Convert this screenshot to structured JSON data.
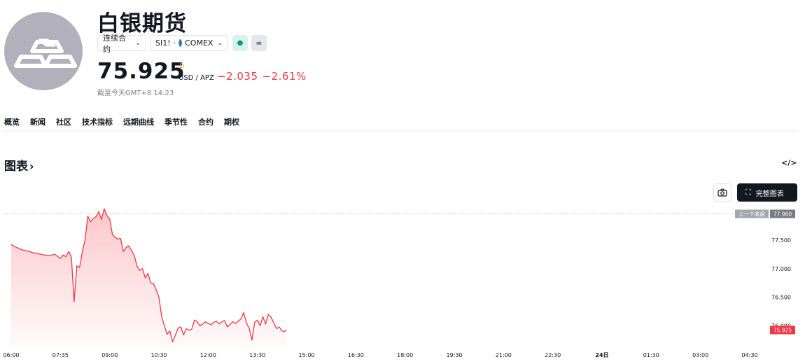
{
  "header": {
    "title": "白银期货",
    "contract_selector": "连续合约",
    "symbol": "SI1!",
    "exchange": "COMEX",
    "price": "75.925",
    "price_flag": "D",
    "currency": "USD / APZ",
    "change": "−2.035",
    "change_pct": "−2.61%",
    "asof": "截至今天GMT+8 14:23"
  },
  "tabs": [
    {
      "label": "概览"
    },
    {
      "label": "新闻"
    },
    {
      "label": "社区"
    },
    {
      "label": "技术指标"
    },
    {
      "label": "远期曲线"
    },
    {
      "label": "季节性"
    },
    {
      "label": "合约"
    },
    {
      "label": "期权"
    }
  ],
  "section": {
    "title": "图表",
    "embed": "</>",
    "fullchart": "完整图表"
  },
  "chart_data": {
    "type": "area",
    "x_ticks": [
      "06:00",
      "07:35",
      "09:00",
      "10:30",
      "12:00",
      "13:30",
      "15:00",
      "16:30",
      "18:00",
      "19:30",
      "21:00",
      "22:30",
      "24日",
      "01:30",
      "03:00",
      "04:30"
    ],
    "y_ticks": [
      "77.500",
      "77.000",
      "76.500",
      "76.000"
    ],
    "ylim": [
      75.6,
      78.15
    ],
    "prev_close": {
      "label": "上一个收盘",
      "value": 77.96,
      "text": "77.960"
    },
    "last": {
      "value": 75.925,
      "text": "75.925"
    },
    "series": [
      {
        "color": "#f23645",
        "x": [
          "06:00",
          "06:10",
          "06:20",
          "06:30",
          "06:40",
          "06:50",
          "07:00",
          "07:10",
          "07:20",
          "07:30",
          "07:35",
          "07:40",
          "07:45",
          "07:50",
          "07:55",
          "08:00",
          "08:05",
          "08:10",
          "08:15",
          "08:20",
          "08:25",
          "08:30",
          "08:35",
          "08:40",
          "08:45",
          "08:50",
          "08:55",
          "09:00",
          "09:05",
          "09:10",
          "09:15",
          "09:20",
          "09:25",
          "09:30",
          "09:35",
          "09:40",
          "09:45",
          "09:50",
          "09:55",
          "10:00",
          "10:05",
          "10:10",
          "10:15",
          "10:20",
          "10:25",
          "10:30",
          "10:35",
          "10:40",
          "10:45",
          "10:50",
          "10:55",
          "11:00",
          "11:05",
          "11:10",
          "11:15",
          "11:20",
          "11:25",
          "11:30",
          "11:35",
          "11:40",
          "11:45",
          "11:50",
          "11:55",
          "12:00",
          "12:05",
          "12:10",
          "12:15",
          "12:20",
          "12:25",
          "12:30",
          "12:35",
          "12:40",
          "12:45",
          "12:50",
          "12:55",
          "13:00",
          "13:05",
          "13:10",
          "13:15",
          "13:20",
          "13:25",
          "13:30",
          "13:35",
          "13:40",
          "13:45",
          "13:50",
          "13:55",
          "14:00",
          "14:05",
          "14:10",
          "14:15",
          "14:20",
          "14:23"
        ],
        "y": [
          77.42,
          77.37,
          77.33,
          77.31,
          77.28,
          77.26,
          77.24,
          77.23,
          77.25,
          77.18,
          77.24,
          77.21,
          77.3,
          77.2,
          76.42,
          77.05,
          77.02,
          77.3,
          77.5,
          77.92,
          77.82,
          77.88,
          77.91,
          78.0,
          77.86,
          78.05,
          77.93,
          77.87,
          77.6,
          77.55,
          77.52,
          77.53,
          77.3,
          77.37,
          77.4,
          77.32,
          77.23,
          77.05,
          76.97,
          77.0,
          76.84,
          76.92,
          76.75,
          76.74,
          76.63,
          76.5,
          76.17,
          76.0,
          75.85,
          75.91,
          75.72,
          75.83,
          75.96,
          75.98,
          75.84,
          75.95,
          75.92,
          75.94,
          76.1,
          76.07,
          76.0,
          76.03,
          76.07,
          76.04,
          76.02,
          76.06,
          76.08,
          76.03,
          76.07,
          76.09,
          75.98,
          76.02,
          76.07,
          76.04,
          76.08,
          76.12,
          76.23,
          76.05,
          75.96,
          75.75,
          76.06,
          76.1,
          76.0,
          76.16,
          76.03,
          76.2,
          76.15,
          76.05,
          75.95,
          75.98,
          75.91,
          75.9,
          75.925
        ]
      }
    ]
  }
}
